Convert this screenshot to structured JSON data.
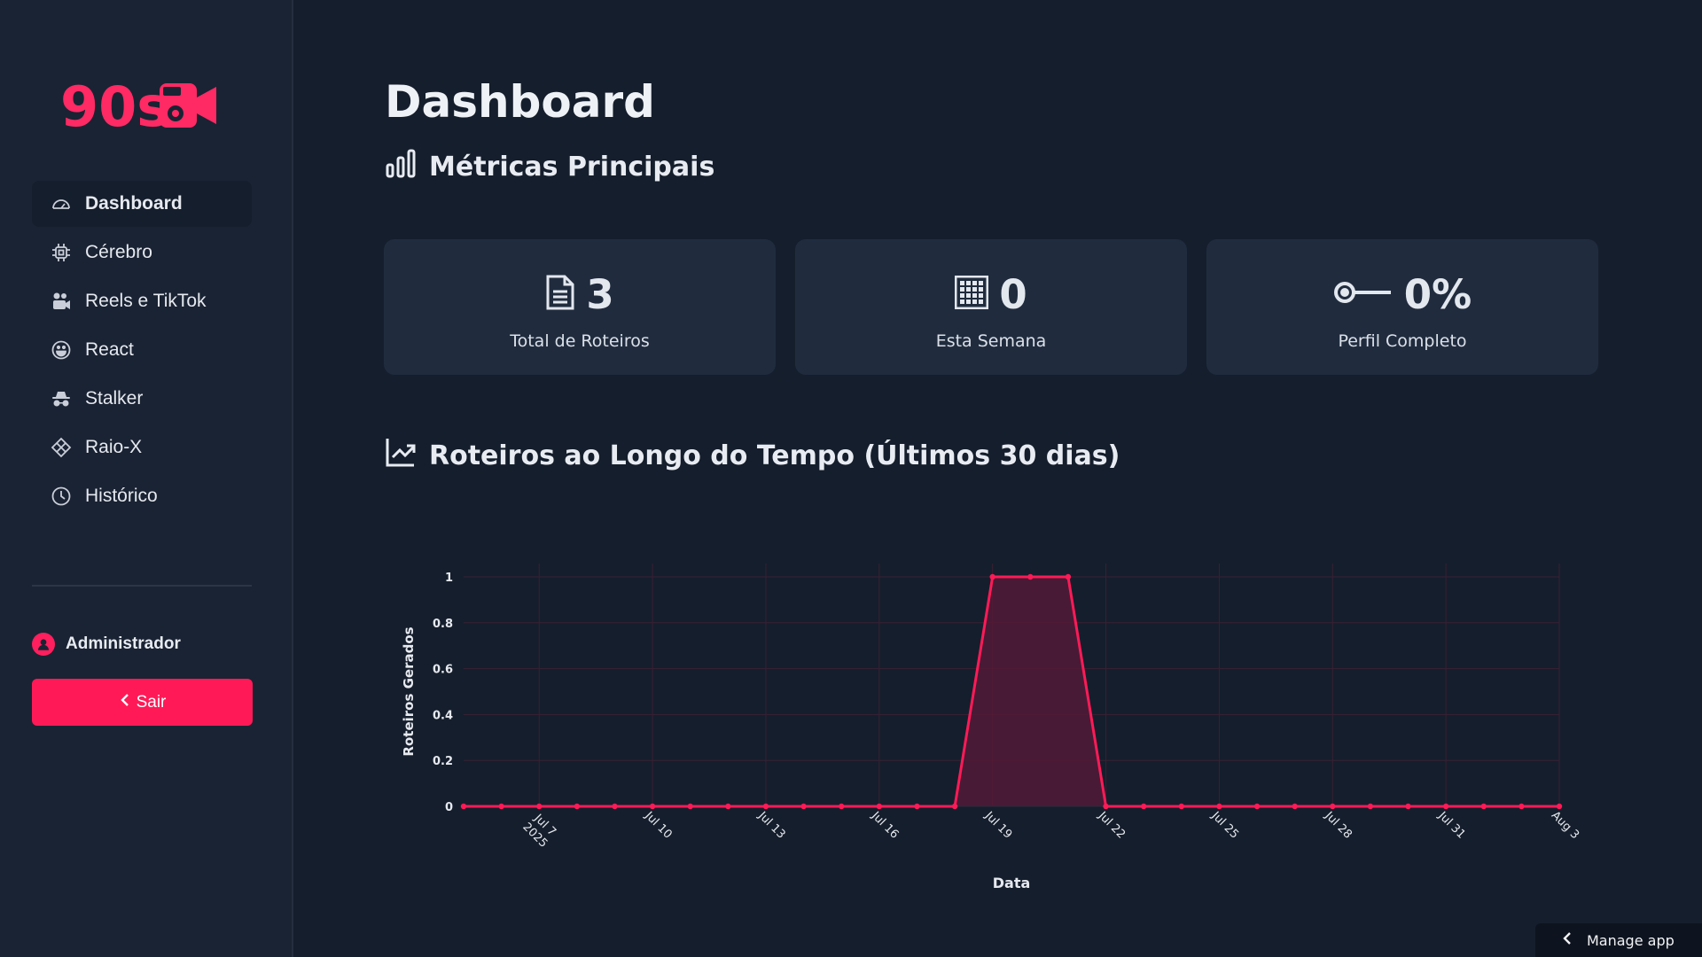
{
  "app": {
    "logo_text": "90s"
  },
  "sidebar": {
    "items": [
      {
        "label": "Dashboard",
        "icon": "speedometer-icon",
        "active": true
      },
      {
        "label": "Cérebro",
        "icon": "cpu-icon"
      },
      {
        "label": "Reels e TikTok",
        "icon": "camera-reels-icon"
      },
      {
        "label": "React",
        "icon": "smiley-icon"
      },
      {
        "label": "Stalker",
        "icon": "incognito-icon"
      },
      {
        "label": "Raio-X",
        "icon": "diamond-grid-icon"
      },
      {
        "label": "Histórico",
        "icon": "clock-icon"
      }
    ],
    "user": {
      "name": "Administrador",
      "icon": "person-circle-icon"
    },
    "logout_label": "Sair"
  },
  "main": {
    "title": "Dashboard",
    "metrics_title": "Métricas Principais",
    "metrics": [
      {
        "value": "3",
        "label": "Total de Roteiros",
        "icon": "document-icon"
      },
      {
        "value": "0",
        "label": "Esta Semana",
        "icon": "calendar-grid-icon"
      },
      {
        "value": "0%",
        "label": "Perfil Completo",
        "icon": "key-icon"
      }
    ],
    "chart_title": "Roteiros ao Longo do Tempo (Últimos 30 dias)"
  },
  "chart_data": {
    "type": "area",
    "title": "",
    "xlabel": "Data",
    "ylabel": "Roteiros Gerados",
    "ylim": [
      0,
      1
    ],
    "yticks": [
      "0",
      "0.2",
      "0.4",
      "0.6",
      "0.8",
      "1"
    ],
    "xticks": [
      "Jul 7\n2025",
      "Jul 10",
      "Jul 13",
      "Jul 16",
      "Jul 19",
      "Jul 22",
      "Jul 25",
      "Jul 28",
      "Jul 31",
      "Aug 3"
    ],
    "x": [
      "2025-07-05",
      "2025-07-06",
      "2025-07-07",
      "2025-07-08",
      "2025-07-09",
      "2025-07-10",
      "2025-07-11",
      "2025-07-12",
      "2025-07-13",
      "2025-07-14",
      "2025-07-15",
      "2025-07-16",
      "2025-07-17",
      "2025-07-18",
      "2025-07-19",
      "2025-07-20",
      "2025-07-21",
      "2025-07-22",
      "2025-07-23",
      "2025-07-24",
      "2025-07-25",
      "2025-07-26",
      "2025-07-27",
      "2025-07-28",
      "2025-07-29",
      "2025-07-30",
      "2025-07-31",
      "2025-08-01",
      "2025-08-02",
      "2025-08-03"
    ],
    "values": [
      0,
      0,
      0,
      0,
      0,
      0,
      0,
      0,
      0,
      0,
      0,
      0,
      0,
      0,
      1,
      1,
      1,
      0,
      0,
      0,
      0,
      0,
      0,
      0,
      0,
      0,
      0,
      0,
      0,
      0
    ],
    "color": "#ff1a57",
    "grid": true
  },
  "footer": {
    "manage_label": "Manage app"
  }
}
